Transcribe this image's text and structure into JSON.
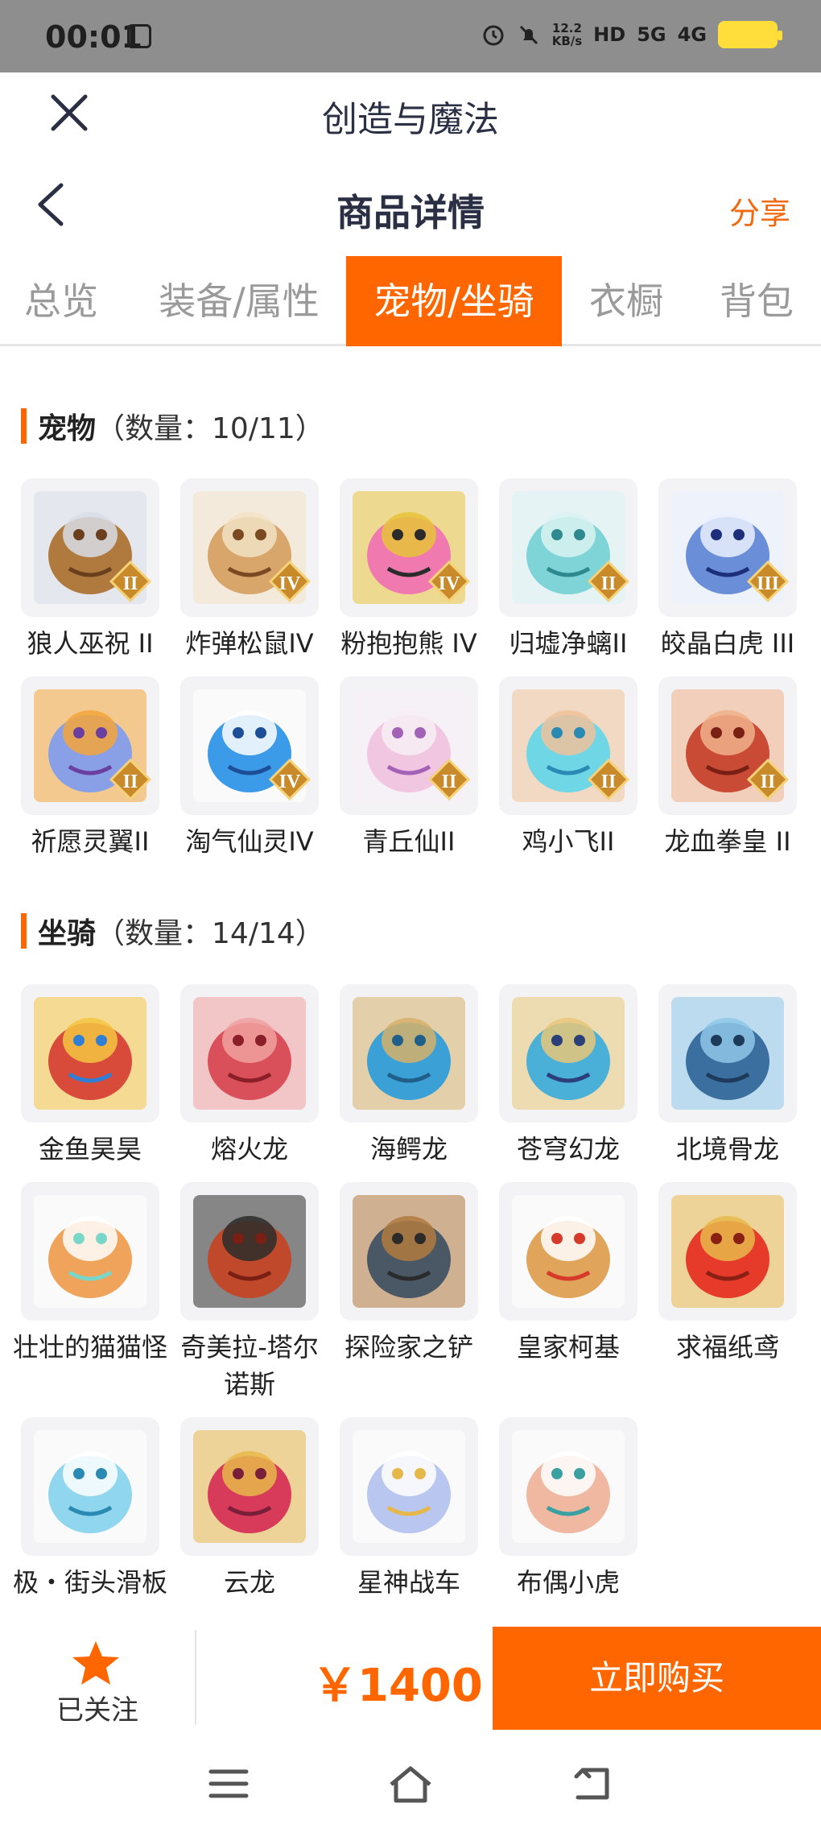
{
  "status": {
    "time": "00:01",
    "speed_value": "12.2",
    "speed_unit": "KB/s",
    "hd": "HD",
    "net1": "5G",
    "net2": "4G"
  },
  "top_bar": {
    "title": "创造与魔法"
  },
  "header": {
    "title": "商品详情",
    "share": "分享"
  },
  "tabs": [
    {
      "label": "总览",
      "active": false
    },
    {
      "label": "装备/属性",
      "active": false
    },
    {
      "label": "宠物/坐骑",
      "active": true
    },
    {
      "label": "衣橱",
      "active": false
    },
    {
      "label": "背包",
      "active": false
    }
  ],
  "pets": {
    "title": "宠物",
    "count": "（数量：10/11）",
    "items": [
      {
        "name": "狼人巫祝 II",
        "tier": "II",
        "icon": "werewolf-shaman"
      },
      {
        "name": "炸弹松鼠IV",
        "tier": "IV",
        "icon": "bomb-squirrel"
      },
      {
        "name": "粉抱抱熊 IV",
        "tier": "IV",
        "icon": "pink-bear"
      },
      {
        "name": "归墟净螭II",
        "tier": "II",
        "icon": "water-dragon"
      },
      {
        "name": "皎晶白虎 III",
        "tier": "III",
        "icon": "white-tiger"
      },
      {
        "name": "祈愿灵翼II",
        "tier": "II",
        "icon": "eagle"
      },
      {
        "name": "淘气仙灵IV",
        "tier": "IV",
        "icon": "blue-dog"
      },
      {
        "name": "青丘仙II",
        "tier": "II",
        "icon": "fox-fairy"
      },
      {
        "name": "鸡小飞II",
        "tier": "II",
        "icon": "chick"
      },
      {
        "name": "龙血拳皇 II",
        "tier": "II",
        "icon": "ram-warrior"
      }
    ]
  },
  "mounts": {
    "title": "坐骑",
    "count": "（数量：14/14）",
    "items": [
      {
        "name": "金鱼昊昊",
        "icon": "goldfish"
      },
      {
        "name": "熔火龙",
        "icon": "magma-dragon"
      },
      {
        "name": "海鳄龙",
        "icon": "sea-dragon"
      },
      {
        "name": "苍穹幻龙",
        "icon": "sky-dragon"
      },
      {
        "name": "北境骨龙",
        "icon": "bone-dragon"
      },
      {
        "name": "壮壮的猫猫怪",
        "icon": "cat-monster"
      },
      {
        "name": "奇美拉-塔尔诺斯",
        "icon": "chimera"
      },
      {
        "name": "探险家之铲",
        "icon": "shovel"
      },
      {
        "name": "皇家柯基",
        "icon": "corgi"
      },
      {
        "name": "求福纸鸢",
        "icon": "kite-fish"
      },
      {
        "name": "极・街头滑板",
        "icon": "skateboard"
      },
      {
        "name": "云龙",
        "icon": "cloud-dragon"
      },
      {
        "name": "星神战车",
        "icon": "star-chariot"
      },
      {
        "name": "布偶小虎",
        "icon": "doll-tiger"
      }
    ]
  },
  "footer": {
    "follow_label": "已关注",
    "price": "￥1400",
    "buy_label": "立即购买"
  },
  "colors": {
    "accent": "#ff6600",
    "share": "#f26a10",
    "status_bar": "#8e8e8e"
  }
}
